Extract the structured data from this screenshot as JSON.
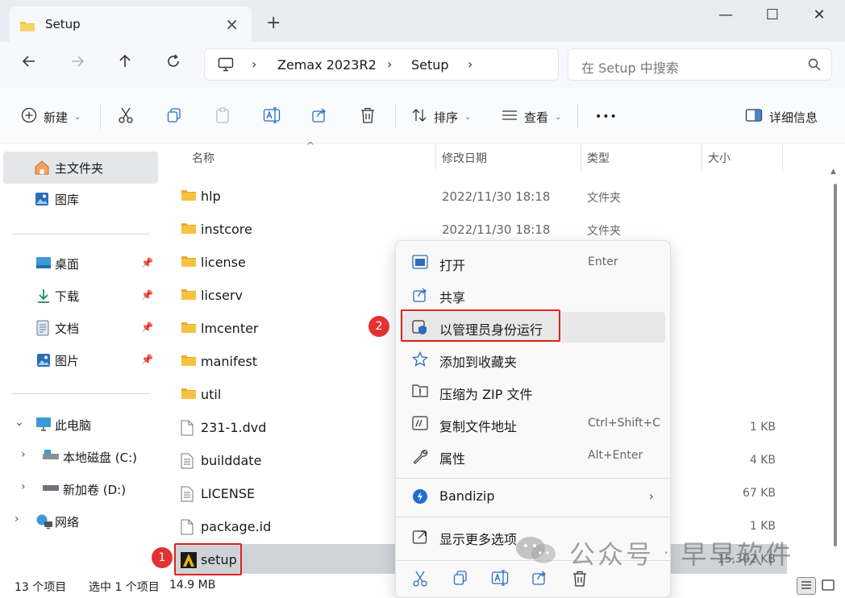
{
  "window": {
    "tab_title": "Setup",
    "tab_close": "×",
    "new_tab": "+",
    "minimize": "—",
    "maximize": "☐",
    "close": "✕"
  },
  "address": {
    "crumbs": [
      "Zemax 2023R2",
      "Setup"
    ],
    "search_placeholder": "在 Setup 中搜索"
  },
  "toolbar": {
    "new_label": "新建",
    "sort_label": "排序",
    "view_label": "查看",
    "more_label": "•••",
    "details_label": "详细信息"
  },
  "sidebar": {
    "home": "主文件夹",
    "gallery": "图库",
    "quick": [
      "桌面",
      "下载",
      "文档",
      "图片"
    ],
    "this_pc": "此电脑",
    "drives": [
      "本地磁盘 (C:)",
      "新加卷 (D:)"
    ],
    "network": "网络"
  },
  "columns": {
    "name": "名称",
    "date": "修改日期",
    "type": "类型",
    "size": "大小"
  },
  "files": [
    {
      "name": "hlp",
      "date": "2022/11/30 18:18",
      "type": "文件夹",
      "size": "",
      "icon": "folder"
    },
    {
      "name": "instcore",
      "date": "2022/11/30 18:18",
      "type": "文件夹",
      "size": "",
      "icon": "folder"
    },
    {
      "name": "license",
      "date": "",
      "type": "",
      "size": "",
      "icon": "folder"
    },
    {
      "name": "licserv",
      "date": "",
      "type": "",
      "size": "",
      "icon": "folder"
    },
    {
      "name": "lmcenter",
      "date": "",
      "type": "",
      "size": "",
      "icon": "folder"
    },
    {
      "name": "manifest",
      "date": "",
      "type": "",
      "size": "",
      "icon": "folder"
    },
    {
      "name": "util",
      "date": "",
      "type": "",
      "size": "",
      "icon": "folder"
    },
    {
      "name": "231-1.dvd",
      "date": "",
      "type": "",
      "size": "1 KB",
      "icon": "file"
    },
    {
      "name": "builddate",
      "date": "",
      "type": "",
      "size": "4 KB",
      "icon": "file"
    },
    {
      "name": "LICENSE",
      "date": "",
      "type": "",
      "size": "67 KB",
      "icon": "file"
    },
    {
      "name": "package.id",
      "date": "",
      "type": "",
      "size": "1 KB",
      "icon": "file"
    },
    {
      "name": "setup",
      "date": "",
      "type": "",
      "size": "15,302 KB",
      "icon": "setup-app"
    }
  ],
  "context_menu": {
    "open": "打开",
    "open_key": "Enter",
    "share": "共享",
    "run_as_admin": "以管理员身份运行",
    "favorite": "添加到收藏夹",
    "zip": "压缩为 ZIP 文件",
    "copy_path": "复制文件地址",
    "copy_path_key": "Ctrl+Shift+C",
    "properties": "属性",
    "properties_key": "Alt+Enter",
    "bandizip": "Bandizip",
    "more_options": "显示更多选项"
  },
  "annotations": {
    "badge1": "1",
    "badge2": "2"
  },
  "status": {
    "count": "13 个项目",
    "selected": "选中 1 个项目",
    "size": "14.9 MB"
  },
  "watermark": {
    "left": "公众号",
    "dot": "·",
    "right": "早早软件"
  },
  "colors": {
    "accent": "#0067c0",
    "folder": "#f5c242",
    "annotation": "#e02020"
  }
}
